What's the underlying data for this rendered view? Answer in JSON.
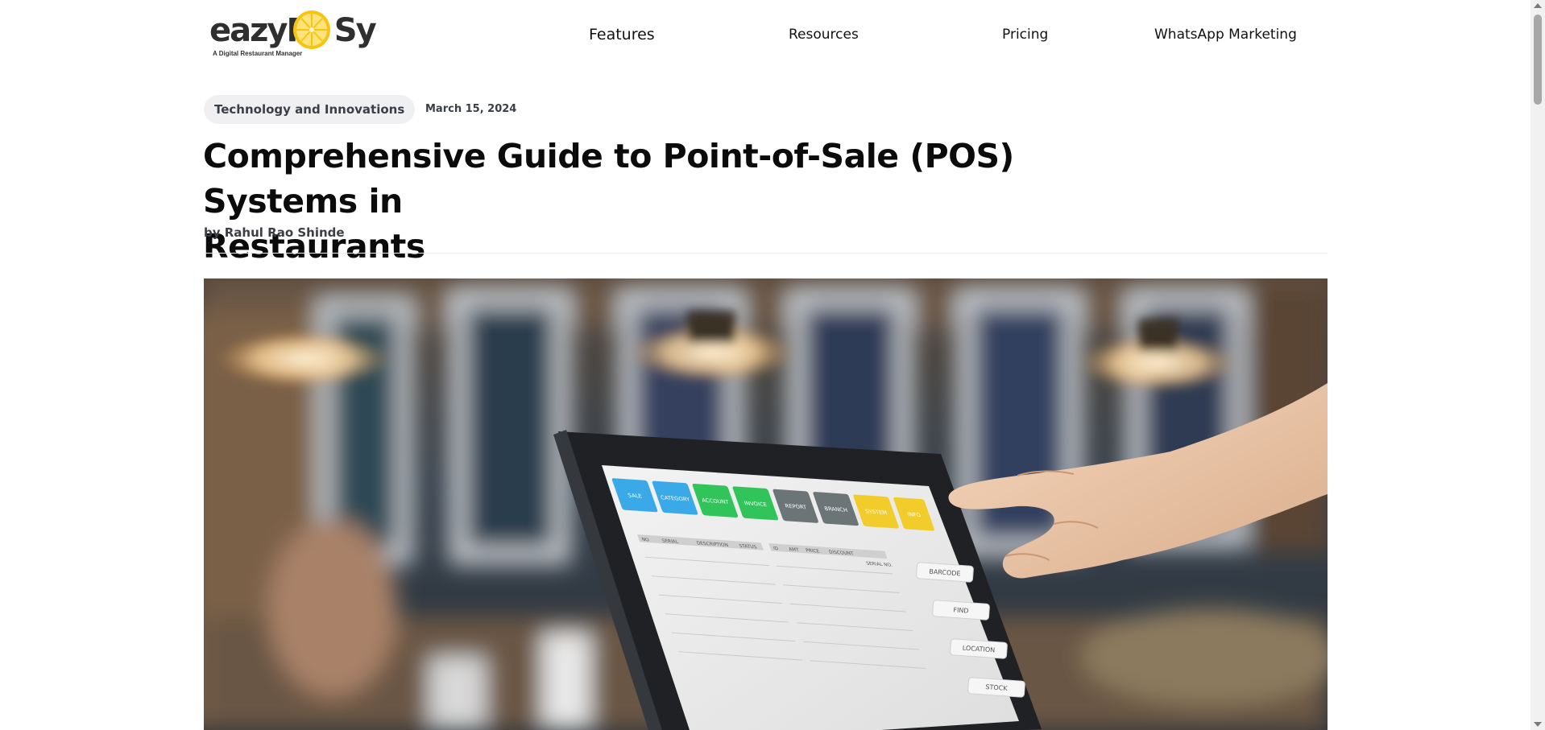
{
  "brand": {
    "name_left": "eazyP",
    "name_right": "Sy",
    "tagline": "A Digital Restaurant Manager",
    "accent_color": "#f6c514"
  },
  "nav": {
    "items": [
      {
        "label": "Features"
      },
      {
        "label": "Resources"
      },
      {
        "label": "Pricing"
      },
      {
        "label": "WhatsApp Marketing"
      }
    ]
  },
  "article": {
    "category": "Technology and Innovations",
    "date": "March 15, 2024",
    "title_line1": "Comprehensive Guide to Point-of-Sale (POS) Systems in",
    "title_line2": "Restaurants",
    "byline_prefix": "by",
    "author": "Rahul Rao Shinde"
  },
  "hero": {
    "pos_buttons": [
      {
        "label": "SALE",
        "color": "#39a9e8"
      },
      {
        "label": "CATEGORY",
        "color": "#39a9e8"
      },
      {
        "label": "ACCOUNT",
        "color": "#30c45a"
      },
      {
        "label": "INVOICE",
        "color": "#30c45a"
      },
      {
        "label": "REPORT",
        "color": "#6b7476"
      },
      {
        "label": "BRANCH",
        "color": "#6b7476"
      },
      {
        "label": "SYSTEM",
        "color": "#f2cc2a"
      },
      {
        "label": "INFO",
        "color": "#f2cc2a"
      }
    ],
    "table_headers": [
      "NO",
      "SERIAL",
      "DESCRIPTION",
      "STATUS"
    ],
    "right_headers": [
      "ID",
      "AMT",
      "PRICE",
      "DISCOUNT"
    ],
    "side_buttons": [
      "BARCODE",
      "FIND",
      "LOCATION",
      "STOCK"
    ],
    "serial_label": "SERIAL NO."
  }
}
